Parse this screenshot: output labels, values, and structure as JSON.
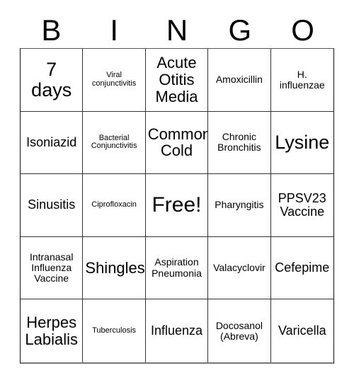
{
  "card": {
    "title_letters": [
      "B",
      "I",
      "N",
      "G",
      "O"
    ],
    "free_space_index": 12,
    "grid_size": "5x5",
    "text_color": "#000000",
    "background_color": "#ffffff",
    "border_color": "#333333"
  },
  "cells": [
    {
      "text": "7\ndays",
      "size": "fs-xl"
    },
    {
      "text": "Viral\nconjunctivitis",
      "size": "fs-xs"
    },
    {
      "text": "Acute\nOtitis\nMedia",
      "size": "fs-lg"
    },
    {
      "text": "Amoxicillin",
      "size": "fs-sm"
    },
    {
      "text": "H.\ninfluenzae",
      "size": "fs-sm"
    },
    {
      "text": "Isoniazid",
      "size": "fs-md"
    },
    {
      "text": "Bacterial\nConjunctivitis",
      "size": "fs-xs"
    },
    {
      "text": "Common\nCold",
      "size": "fs-lg"
    },
    {
      "text": "Chronic\nBronchitis",
      "size": "fs-sm"
    },
    {
      "text": "Lysine",
      "size": "fs-xl"
    },
    {
      "text": "Sinusitis",
      "size": "fs-md"
    },
    {
      "text": "Ciprofloxacin",
      "size": "fs-xs"
    },
    {
      "text": "Free!",
      "size": "fs-free"
    },
    {
      "text": "Pharyngitis",
      "size": "fs-sm"
    },
    {
      "text": "PPSV23\nVaccine",
      "size": "fs-md"
    },
    {
      "text": "Intranasal\nInfluenza\nVaccine",
      "size": "fs-sm"
    },
    {
      "text": "Shingles",
      "size": "fs-lg"
    },
    {
      "text": "Aspiration\nPneumonia",
      "size": "fs-sm"
    },
    {
      "text": "Valacyclovir",
      "size": "fs-sm"
    },
    {
      "text": "Cefepime",
      "size": "fs-md"
    },
    {
      "text": "Herpes\nLabialis",
      "size": "fs-lg"
    },
    {
      "text": "Tuberculosis",
      "size": "fs-xs"
    },
    {
      "text": "Influenza",
      "size": "fs-md"
    },
    {
      "text": "Docosanol\n(Abreva)",
      "size": "fs-sm"
    },
    {
      "text": "Varicella",
      "size": "fs-md"
    }
  ]
}
